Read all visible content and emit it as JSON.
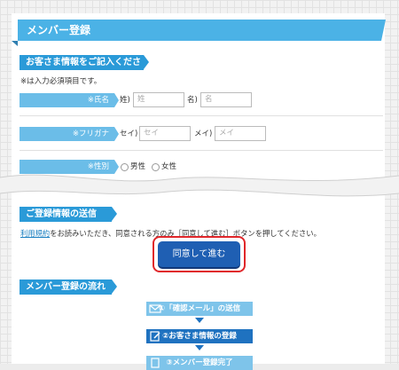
{
  "main_title": "メンバー登録",
  "section_info": "お客さま情報をご記入ください",
  "required_note": "※は入力必須項目です。",
  "fields": {
    "name_label": "※氏名",
    "sei_label": "姓)",
    "sei_placeholder": "姓",
    "mei_label": "名)",
    "mei_placeholder": "名",
    "kana_label": "※フリガナ",
    "sei_kana_label": "セイ)",
    "sei_kana_placeholder": "セイ",
    "mei_kana_label": "メイ)",
    "mei_kana_placeholder": "メイ",
    "gender_label": "※性別",
    "male": "男性",
    "female": "女性"
  },
  "section_send": "ご登録情報の送信",
  "terms_link": "利用規約",
  "terms_text": "をお読みいただき、同意される方のみ［同意して進む］ボタンを押してください。",
  "agree_button": "同意して進む",
  "section_flow": "メンバー登録の流れ",
  "steps": [
    "①「確認メール」の送信",
    "②お客さま情報の登録",
    "③メンバー登録完了"
  ],
  "colors": {
    "accent": "#3aa6dd",
    "button": "#1f5fb3",
    "highlight": "#e0262a"
  }
}
